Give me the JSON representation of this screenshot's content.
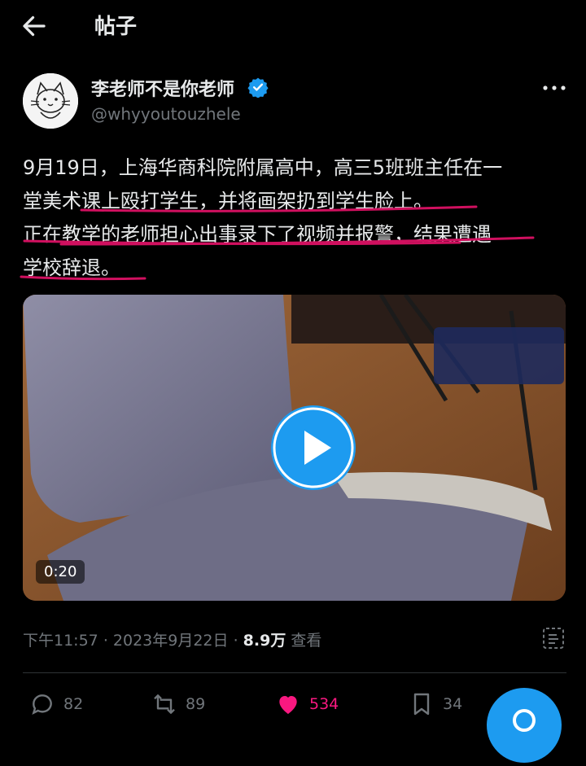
{
  "header": {
    "title": "帖子",
    "back_icon": "arrow-left-icon"
  },
  "author": {
    "name": "李老师不是你老师",
    "handle": "@whyyoutouzhele",
    "verified": true
  },
  "tweet": {
    "lines": [
      "9月19日，上海华商科院附属高中，高三5班班主任在一",
      "堂美术课上殴打学生，并将画架扔到学生脸上。",
      "正在教学的老师担心出事录下了视频并报警，结果遭遇",
      "学校辞退。"
    ]
  },
  "media": {
    "duration": "0:20",
    "type": "video"
  },
  "meta": {
    "time": "下午11:57",
    "date": "2023年9月22日",
    "views_count": "8.9万",
    "views_label": "查看",
    "separator": "·"
  },
  "actions": {
    "reply_count": "82",
    "retweet_count": "89",
    "like_count": "534",
    "bookmark_count": "34"
  },
  "colors": {
    "accent": "#1d9bf0",
    "like": "#f91880",
    "underline": "#d0105f",
    "muted": "#71767b"
  }
}
